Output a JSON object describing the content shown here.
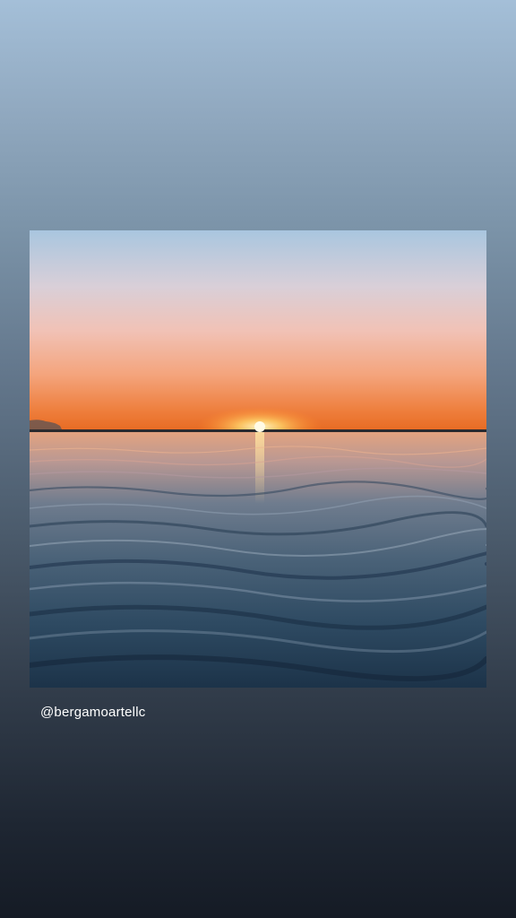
{
  "story": {
    "photo_description_icon": "sunset-over-water-photo",
    "mention": "@bergamoartellc"
  },
  "colors": {
    "background_top": "#a4bfd8",
    "background_bottom": "#151b25",
    "text": "#ffffff"
  }
}
